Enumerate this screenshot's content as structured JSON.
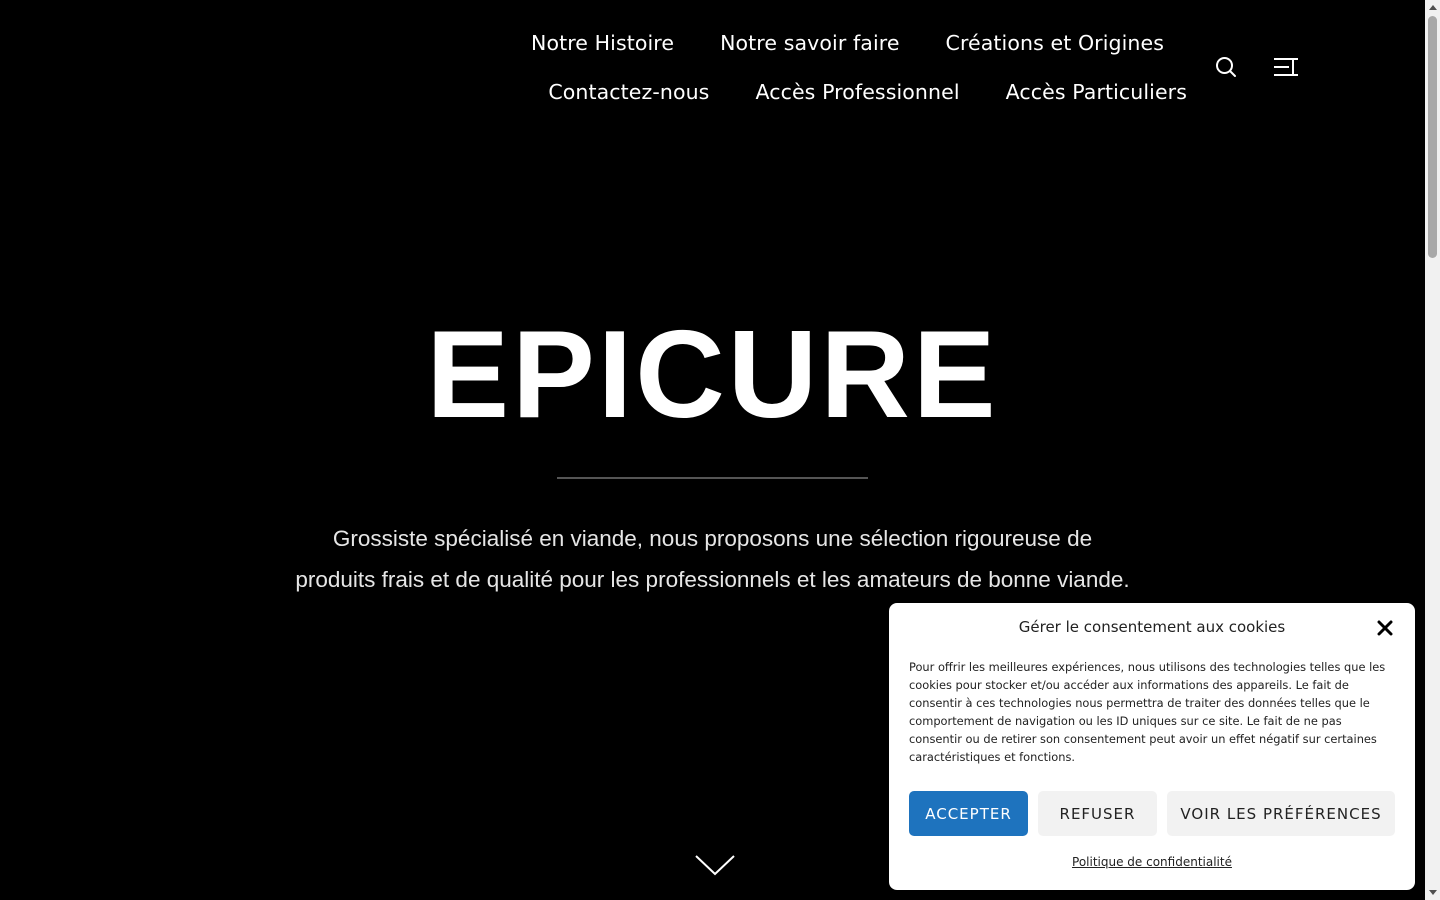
{
  "header": {
    "nav_row1": [
      "Notre Histoire",
      "Notre savoir faire",
      "Créations et Origines"
    ],
    "nav_row2": [
      "Contactez-nous",
      "Accès Professionnel",
      "Accès Particuliers"
    ],
    "icons": [
      "search-icon",
      "menu-icon"
    ]
  },
  "hero": {
    "title": "EPICURE",
    "tagline_line1": "Grossiste spécialisé en viande, nous proposons une sélection rigoureuse de",
    "tagline_line2": "produits frais et de qualité pour les professionnels et les amateurs de bonne viande.",
    "scroll_icon": "chevron-down-icon"
  },
  "cookie_banner": {
    "title": "Gérer le consentement aux cookies",
    "text": "Pour offrir les meilleures expériences, nous utilisons des technologies telles que les cookies pour stocker et/ou accéder aux informations des appareils. Le fait de consentir à ces technologies nous permettra de traiter des données telles que le comportement de navigation ou les ID uniques sur ce site. Le fait de ne pas consentir ou de retirer son consentement peut avoir un effet négatif sur certaines caractéristiques et fonctions.",
    "accept_label": "ACCEPTER",
    "deny_label": "REFUSER",
    "prefs_label": "VOIR LES PRÉFÉRENCES",
    "policy_link": "Politique de confidentialité",
    "accent_color": "#1e73be"
  }
}
